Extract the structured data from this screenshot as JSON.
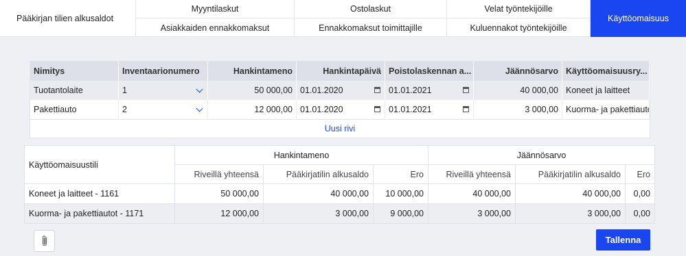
{
  "nav": {
    "first": "Pääkirjan tilien alkusaldot",
    "columns": [
      {
        "top": "Myyntilaskut",
        "bottom": "Asiakkaiden ennakkomaksut"
      },
      {
        "top": "Ostolaskut",
        "bottom": "Ennakkomaksut toimittajille"
      },
      {
        "top": "Velat työntekijöille",
        "bottom": "Kuluennakot työntekijöille"
      }
    ],
    "active": "Käyttöomaisuus"
  },
  "grid": {
    "headers": [
      "Nimitys",
      "Inventaarionumero",
      "Hankintameno",
      "Hankintapäivä",
      "Poistolaskennan a...",
      "Jäännösarvo",
      "Käyttöomaisuusry..."
    ],
    "rows": [
      [
        "Tuotantolaite",
        "1",
        "50 000,00",
        "01.01.2020",
        "01.01.2021",
        "40 000,00",
        "Koneet ja laitteet"
      ],
      [
        "Pakettiauto",
        "2",
        "12 000,00",
        "01.01.2020",
        "01.01.2021",
        "3 000,00",
        "Kuorma- ja pakettiauto"
      ]
    ],
    "new_row_label": "Uusi rivi"
  },
  "summary": {
    "account_header": "Käyttöomaisuustili",
    "group1": "Hankintameno",
    "group2": "Jäännösarvo",
    "subheaders": [
      "Riveillä yhteensä",
      "Pääkirjatilin alkusaldo",
      "Ero",
      "Riveillä yhteensä",
      "Pääkirjatilin alkusaldo",
      "Ero"
    ],
    "rows": [
      [
        "Koneet ja laitteet - 1161",
        "50 000,00",
        "40 000,00",
        "10 000,00",
        "40 000,00",
        "40 000,00",
        "0,00"
      ],
      [
        "Kuorma- ja pakettiautot - 1171",
        "12 000,00",
        "3 000,00",
        "9 000,00",
        "3 000,00",
        "3 000,00",
        "0,00"
      ]
    ]
  },
  "buttons": {
    "save": "Tallenna",
    "attach_icon": "paperclip-icon"
  },
  "colors": {
    "accent": "#1946f0",
    "header_bg": "#dde0e8",
    "page_bg": "#eef0f4"
  }
}
